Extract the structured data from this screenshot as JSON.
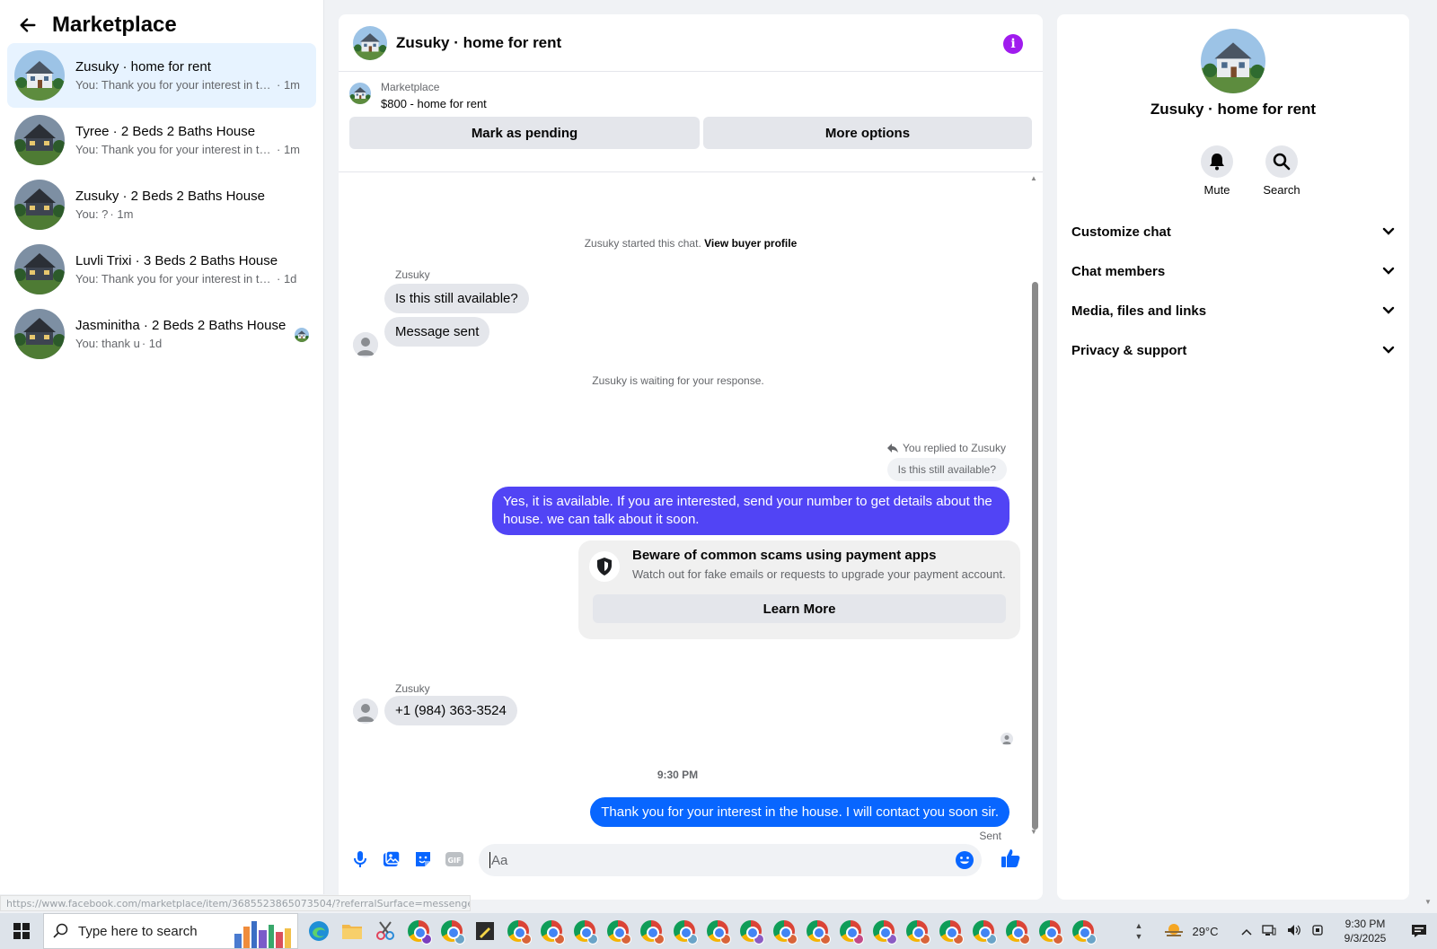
{
  "sidebar": {
    "title": "Marketplace",
    "conversations": [
      {
        "name": "Zusuky · home for rent",
        "preview": "You: Thank you for your interest in th...",
        "time": "· 1m"
      },
      {
        "name": "Tyree · 2 Beds 2 Baths House",
        "preview": "You: Thank you for your interest in th...",
        "time": "· 1m"
      },
      {
        "name": "Zusuky · 2 Beds 2 Baths House",
        "preview": "You: ?",
        "time": "· 1m"
      },
      {
        "name": "Luvli Trixi · 3 Beds 2 Baths House",
        "preview": "You: Thank you for your interest in th...",
        "time": "· 1d"
      },
      {
        "name": "Jasminitha · 2 Beds 2 Baths House",
        "preview": "You: thank u",
        "time": "· 1d"
      }
    ]
  },
  "chat": {
    "title": "Zusuky · home for rent",
    "listing_source": "Marketplace",
    "listing_title": "$800 - home for rent",
    "mark_pending": "Mark as pending",
    "more_options": "More options",
    "started_text": "Zusuky started this chat.",
    "view_profile": "View buyer profile",
    "sender_1": "Zusuky",
    "msg_1": "Is this still available?",
    "msg_2": "Message sent",
    "waiting": "Zusuky is waiting for your response.",
    "replied_to": "You replied to Zusuky",
    "quoted": "Is this still available?",
    "my_reply": "Yes, it is available. If you are interested, send your number to get details about the house. we can talk about it soon.",
    "scam_title": "Beware of common scams using payment apps",
    "scam_desc": "Watch out for fake emails or requests to upgrade your payment account.",
    "learn_more": "Learn More",
    "sender_2": "Zusuky",
    "phone": "+1 (984) 363-3524",
    "timestamp": "9:30 PM",
    "my_last": "Thank you for your interest in the house. I will contact you soon sir.",
    "sent": "Sent",
    "composer_placeholder": "Aa"
  },
  "right_panel": {
    "name": "Zusuky · home for rent",
    "mute": "Mute",
    "search": "Search",
    "sections": [
      "Customize chat",
      "Chat members",
      "Media, files and links",
      "Privacy & support"
    ]
  },
  "status_url": "https://www.facebook.com/marketplace/item/3685523865073504/?referralSurface=messenger_...",
  "taskbar": {
    "search_placeholder": "Type here to search",
    "temperature": "29°C",
    "time": "9:30 PM",
    "date": "9/3/2025"
  },
  "colors": {
    "accent_purple": "#5144f5",
    "accent_blue": "#0866ff",
    "info_purple": "#a01bee"
  }
}
